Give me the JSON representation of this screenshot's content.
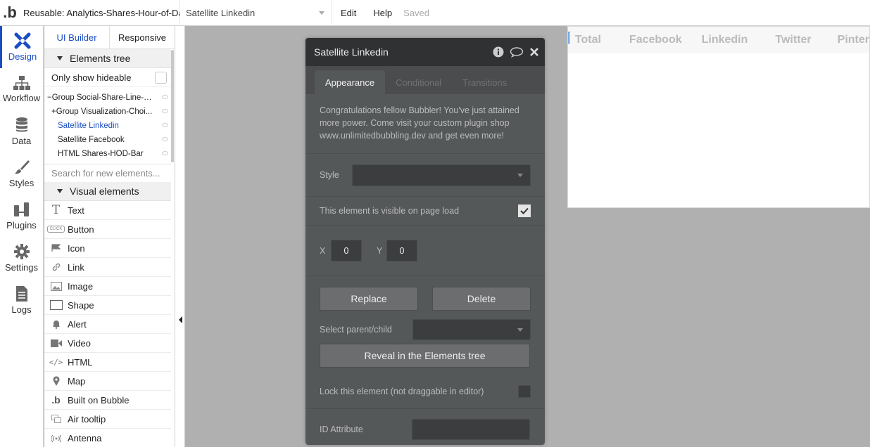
{
  "topbar": {
    "logo": ".b",
    "reusable_label": "Reusable: Analytics-Shares-Hour-of-Day",
    "element_selected": "Satellite Linkedin",
    "menu": [
      "Edit",
      "Help"
    ],
    "status": "Saved"
  },
  "rail": {
    "items": [
      {
        "label": "Design",
        "icon": "design-icon"
      },
      {
        "label": "Workflow",
        "icon": "workflow-icon"
      },
      {
        "label": "Data",
        "icon": "data-icon"
      },
      {
        "label": "Styles",
        "icon": "styles-icon"
      },
      {
        "label": "Plugins",
        "icon": "plugins-icon"
      },
      {
        "label": "Settings",
        "icon": "settings-icon"
      },
      {
        "label": "Logs",
        "icon": "logs-icon"
      }
    ]
  },
  "panel": {
    "tabs": [
      "UI Builder",
      "Responsive"
    ],
    "elements_tree_title": "Elements tree",
    "only_show_hideable": "Only show hideable",
    "tree": [
      {
        "label": "Group Social-Share-Line-C...",
        "prefix": "−"
      },
      {
        "label": "Group Visualization-Choi...",
        "prefix": "+"
      },
      {
        "label": "Satellite Linkedin",
        "prefix": ""
      },
      {
        "label": "Satellite Facebook",
        "prefix": ""
      },
      {
        "label": "HTML Shares-HOD-Bar",
        "prefix": ""
      }
    ],
    "search_placeholder": "Search for new elements...",
    "visual_elements_title": "Visual elements",
    "visual_elements": [
      {
        "label": "Text",
        "icon": "text-icon"
      },
      {
        "label": "Button",
        "icon": "button-icon"
      },
      {
        "label": "Icon",
        "icon": "flag-icon"
      },
      {
        "label": "Link",
        "icon": "link-icon"
      },
      {
        "label": "Image",
        "icon": "image-icon"
      },
      {
        "label": "Shape",
        "icon": "shape-icon"
      },
      {
        "label": "Alert",
        "icon": "bell-icon"
      },
      {
        "label": "Video",
        "icon": "video-icon"
      },
      {
        "label": "HTML",
        "icon": "html-icon"
      },
      {
        "label": "Map",
        "icon": "map-pin-icon"
      },
      {
        "label": "Built on Bubble",
        "icon": "bubble-icon"
      },
      {
        "label": "Air tooltip",
        "icon": "tooltip-icon"
      },
      {
        "label": "Antenna",
        "icon": "antenna-icon"
      }
    ],
    "button_icon_text": "CLICK"
  },
  "canvas": {
    "columns": [
      "Total",
      "Facebook",
      "Linkedin",
      "Twitter",
      "Pinter"
    ]
  },
  "modal": {
    "title": "Satellite Linkedin",
    "tabs": [
      "Appearance",
      "Conditional",
      "Transitions"
    ],
    "promo": "Congratulations fellow Bubbler! You've just attained more power. Come visit your custom plugin shop www.unlimitedbubbling.dev and get even more!",
    "style_label": "Style",
    "visible_label": "This element is visible on page load",
    "x_label": "X",
    "x_value": "0",
    "y_label": "Y",
    "y_value": "0",
    "replace": "Replace",
    "delete": "Delete",
    "parent_child_label": "Select parent/child",
    "reveal": "Reveal in the Elements tree",
    "lock_label": "Lock this element (not draggable in editor)",
    "id_label": "ID Attribute"
  }
}
